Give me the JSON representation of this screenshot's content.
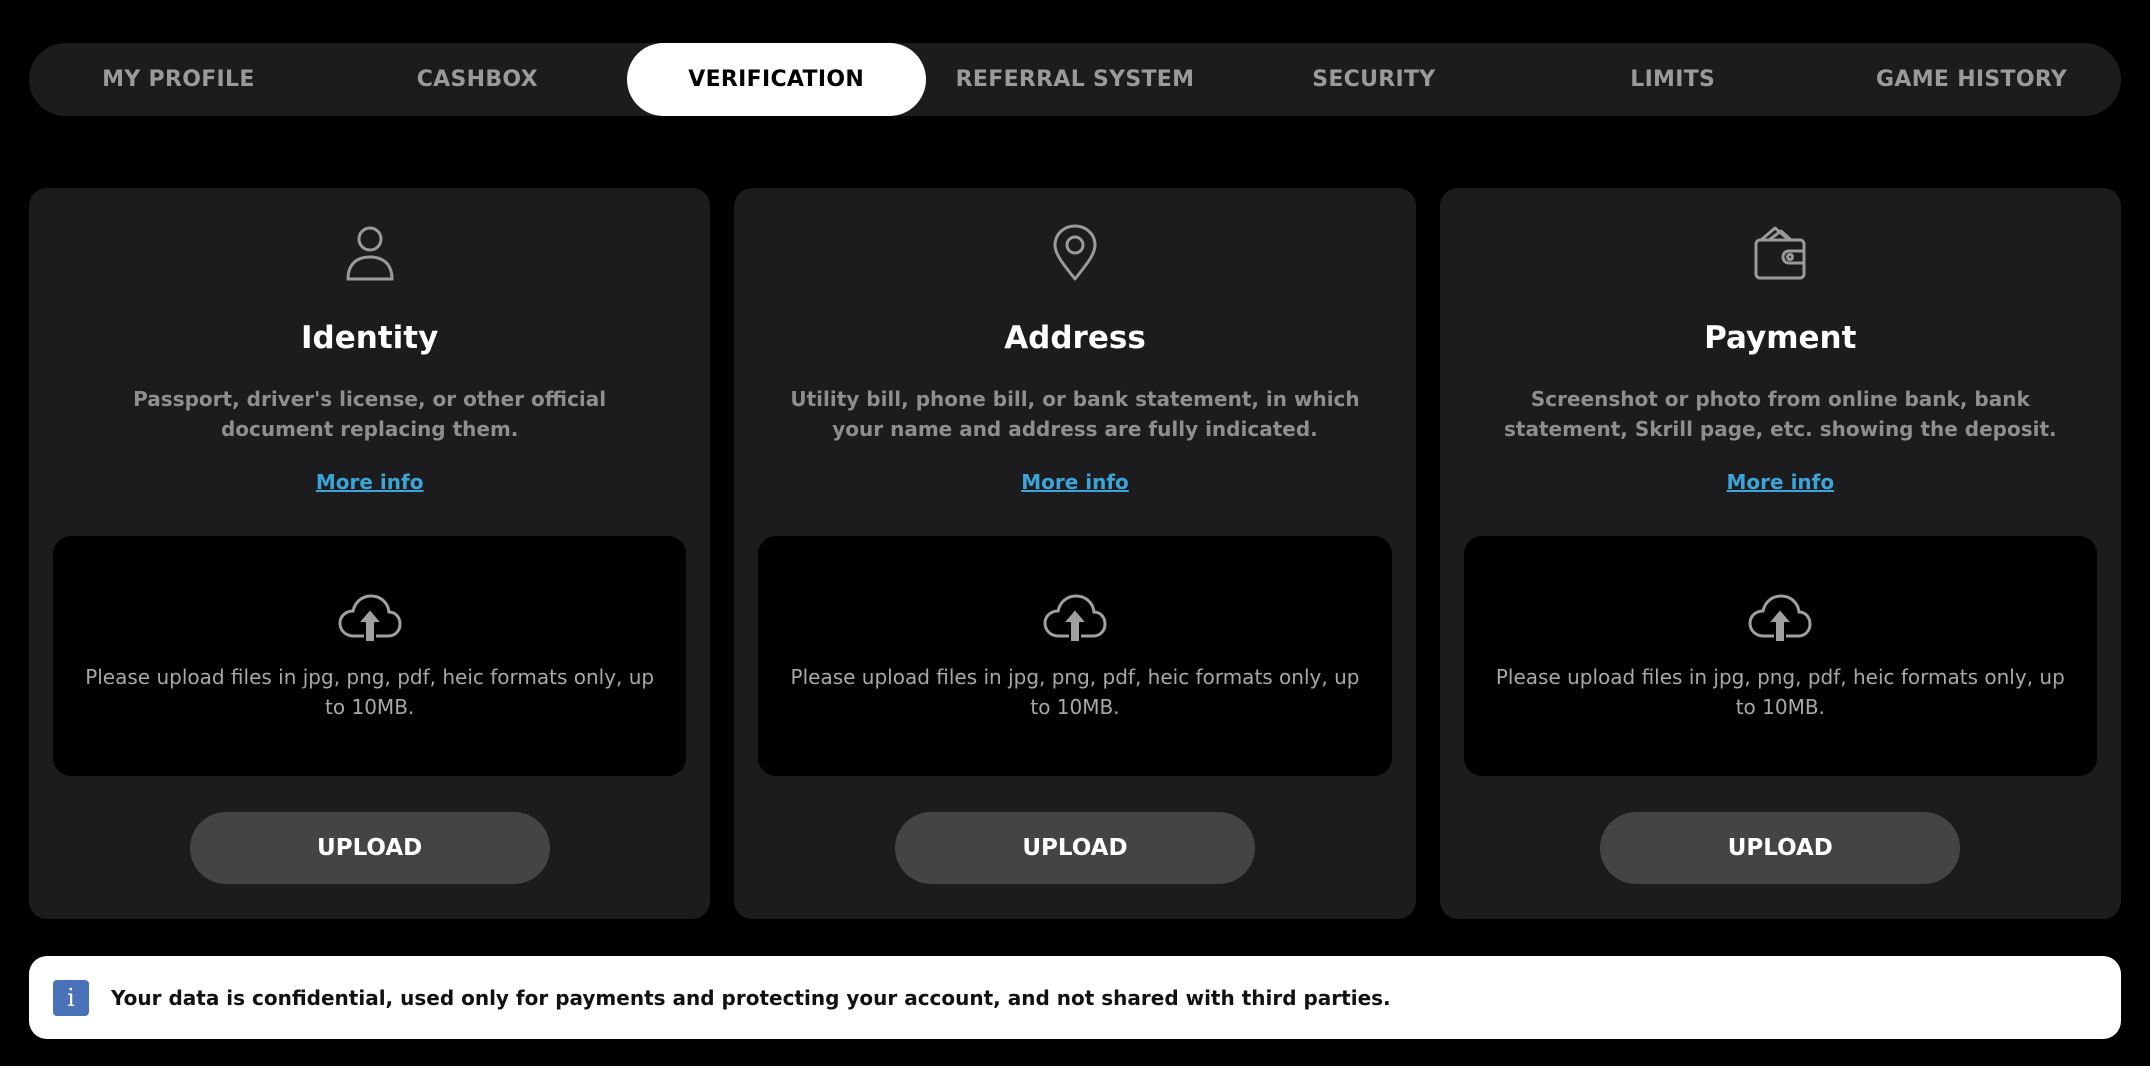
{
  "tabs": [
    {
      "label": "MY PROFILE",
      "active": false
    },
    {
      "label": "CASHBOX",
      "active": false
    },
    {
      "label": "VERIFICATION",
      "active": true
    },
    {
      "label": "REFERRAL SYSTEM",
      "active": false
    },
    {
      "label": "SECURITY",
      "active": false
    },
    {
      "label": "LIMITS",
      "active": false
    },
    {
      "label": "GAME HISTORY",
      "active": false
    }
  ],
  "cards": [
    {
      "icon": "user-icon",
      "title": "Identity",
      "description": "Passport, driver's license, or other official document replacing them.",
      "more_info": "More info",
      "upload_hint": "Please upload files in jpg, png, pdf, heic formats only, up to 10MB.",
      "button": "UPLOAD"
    },
    {
      "icon": "map-pin-icon",
      "title": "Address",
      "description": "Utility bill, phone bill, or bank statement, in which your name and address are fully indicated.",
      "more_info": "More info",
      "upload_hint": "Please upload files in jpg, png, pdf, heic formats only, up to 10MB.",
      "button": "UPLOAD"
    },
    {
      "icon": "wallet-icon",
      "title": "Payment",
      "description": "Screenshot or photo from online bank, bank statement, Skrill page, etc. showing the deposit.",
      "more_info": "More info",
      "upload_hint": "Please upload files in jpg, png, pdf, heic formats only, up to 10MB.",
      "button": "UPLOAD"
    }
  ],
  "notice": {
    "icon_glyph": "i",
    "text": "Your data is confidential, used only for payments and protecting your account, and not shared with third parties."
  },
  "colors": {
    "background": "#000000",
    "panel": "#1c1c1e",
    "link": "#3ba4d8",
    "button": "#444446",
    "info_icon": "#4a72b8"
  }
}
